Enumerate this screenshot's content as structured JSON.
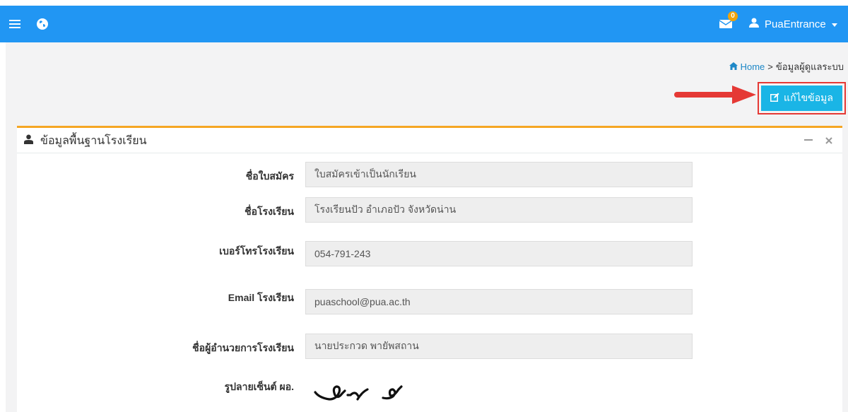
{
  "navbar": {
    "mail_badge": "0",
    "user_name": "PuaEntrance"
  },
  "breadcrumb": {
    "home": "Home",
    "separator": ">",
    "current": "ข้อมูลผู้ดูแลระบบ"
  },
  "edit_button": {
    "label": "แก้ไขข้อมูล"
  },
  "panel": {
    "title": "ข้อมูลพื้นฐานโรงเรียน",
    "fields": [
      {
        "label": "ชื่อใบสมัคร",
        "value": "ใบสมัครเข้าเป็นนักเรียน"
      },
      {
        "label": "ชื่อโรงเรียน",
        "value": "โรงเรียนปัว อำเภอปัว จังหวัดน่าน"
      },
      {
        "label": "เบอร์โทรโรงเรียน",
        "value": "054-791-243"
      },
      {
        "label": "Email โรงเรียน",
        "value": "puaschool@pua.ac.th"
      },
      {
        "label": "ชื่อผู้อำนวยการโรงเรียน",
        "value": "นายประกวด พายัพสถาน"
      }
    ],
    "signature_label": "รูปลายเซ็นต์ ผอ."
  },
  "colors": {
    "navbar": "#2196f3",
    "edit_button": "#1ab5e6",
    "highlight": "#e53935",
    "panel_border": "#f5a623"
  }
}
